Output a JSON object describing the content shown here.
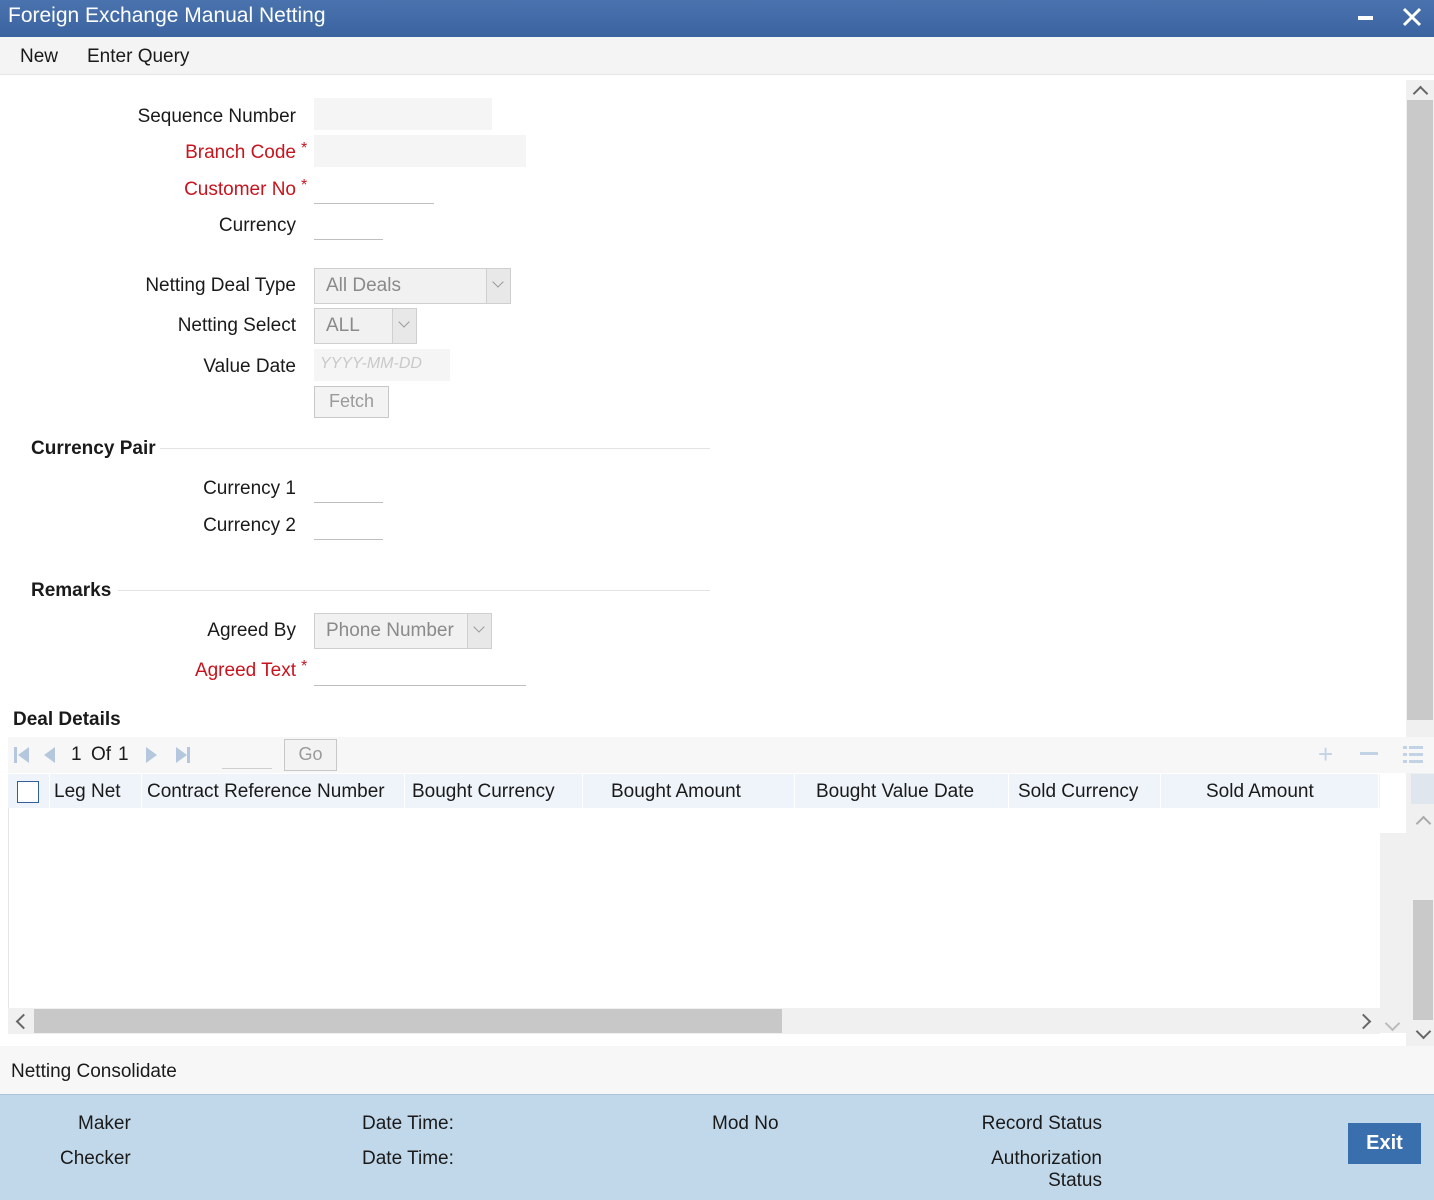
{
  "window": {
    "title": "Foreign Exchange Manual Netting"
  },
  "menu": {
    "new": "New",
    "enter_query": "Enter Query"
  },
  "form": {
    "sequence_number_label": "Sequence Number",
    "branch_code_label": "Branch Code",
    "customer_no_label": "Customer No",
    "currency_label": "Currency",
    "netting_deal_type_label": "Netting Deal Type",
    "netting_deal_type_value": "All Deals",
    "netting_select_label": "Netting Select",
    "netting_select_value": "ALL",
    "value_date_label": "Value Date",
    "value_date_placeholder": "YYYY-MM-DD",
    "fetch_label": "Fetch",
    "required_mark": "*"
  },
  "currency_pair": {
    "title": "Currency Pair",
    "currency1_label": "Currency 1",
    "currency2_label": "Currency 2"
  },
  "remarks": {
    "title": "Remarks",
    "agreed_by_label": "Agreed By",
    "agreed_by_value": "Phone Number",
    "agreed_text_label": "Agreed Text"
  },
  "deal_details": {
    "title": "Deal Details",
    "page_current": "1",
    "page_of": "Of",
    "page_total": "1",
    "go_label": "Go",
    "columns": {
      "leg_net": "Leg Net",
      "contract_ref": "Contract Reference Number",
      "bought_currency": "Bought Currency",
      "bought_amount": "Bought Amount",
      "bought_value_date": "Bought Value Date",
      "sold_currency": "Sold Currency",
      "sold_amount": "Sold Amount"
    }
  },
  "netting_consolidate": "Netting Consolidate",
  "footer": {
    "maker": "Maker",
    "checker": "Checker",
    "date_time1": "Date Time:",
    "date_time2": "Date Time:",
    "mod_no": "Mod No",
    "record_status": "Record Status",
    "authorization": "Authorization",
    "status": "Status",
    "exit": "Exit"
  },
  "colors": {
    "title_bar": "#4a73ae",
    "required": "#c8141e",
    "footer_bg": "#c1d8ea",
    "exit_button": "#3a6fad"
  }
}
